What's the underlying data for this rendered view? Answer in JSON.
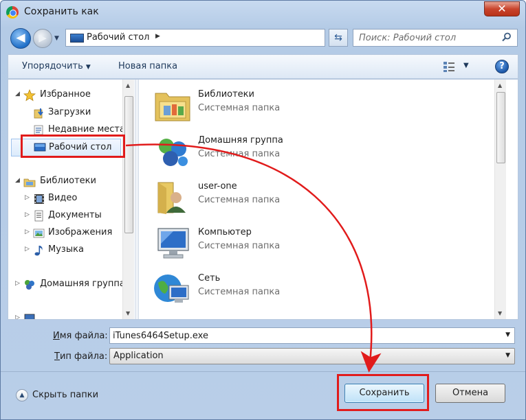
{
  "window": {
    "title": "Сохранить как",
    "close_label": "✕"
  },
  "nav": {
    "address_location": "Рабочий стол",
    "search_placeholder": "Поиск: Рабочий стол"
  },
  "toolbar": {
    "organize_label": "Упорядочить",
    "new_folder_label": "Новая папка",
    "help_label": "?"
  },
  "sidebar": {
    "items": [
      {
        "label": "Избранное",
        "icon": "star-icon"
      },
      {
        "label": "Загрузки",
        "icon": "downloads-icon"
      },
      {
        "label": "Недавние места",
        "icon": "recent-places-icon"
      },
      {
        "label": "Рабочий стол",
        "icon": "desktop-icon",
        "selected": true
      },
      {
        "label": "Библиотеки",
        "icon": "libraries-icon"
      },
      {
        "label": "Видео",
        "icon": "video-icon"
      },
      {
        "label": "Документы",
        "icon": "documents-icon"
      },
      {
        "label": "Изображения",
        "icon": "images-icon"
      },
      {
        "label": "Музыка",
        "icon": "music-icon"
      },
      {
        "label": "Домашняя группа",
        "icon": "homegroup-icon"
      }
    ]
  },
  "files": {
    "items": [
      {
        "name": "Библиотеки",
        "type": "Системная папка",
        "icon": "libraries-folder-icon"
      },
      {
        "name": "Домашняя группа",
        "type": "Системная папка",
        "icon": "homegroup-icon"
      },
      {
        "name": "user-one",
        "type": "Системная папка",
        "icon": "user-folder-icon"
      },
      {
        "name": "Компьютер",
        "type": "Системная папка",
        "icon": "computer-icon"
      },
      {
        "name": "Сеть",
        "type": "Системная папка",
        "icon": "network-icon"
      }
    ]
  },
  "form": {
    "filename_label_accel": "И",
    "filename_label_rest": "мя файла:",
    "filename_value": "iTunes6464Setup.exe",
    "filetype_label_accel": "Т",
    "filetype_label_rest": "ип файла:",
    "filetype_value": "Application"
  },
  "footer": {
    "hide_folders_label": "Скрыть папки",
    "save_label": "Сохранить",
    "cancel_label": "Отмена"
  },
  "annotation": {
    "color": "#e11b1b"
  }
}
